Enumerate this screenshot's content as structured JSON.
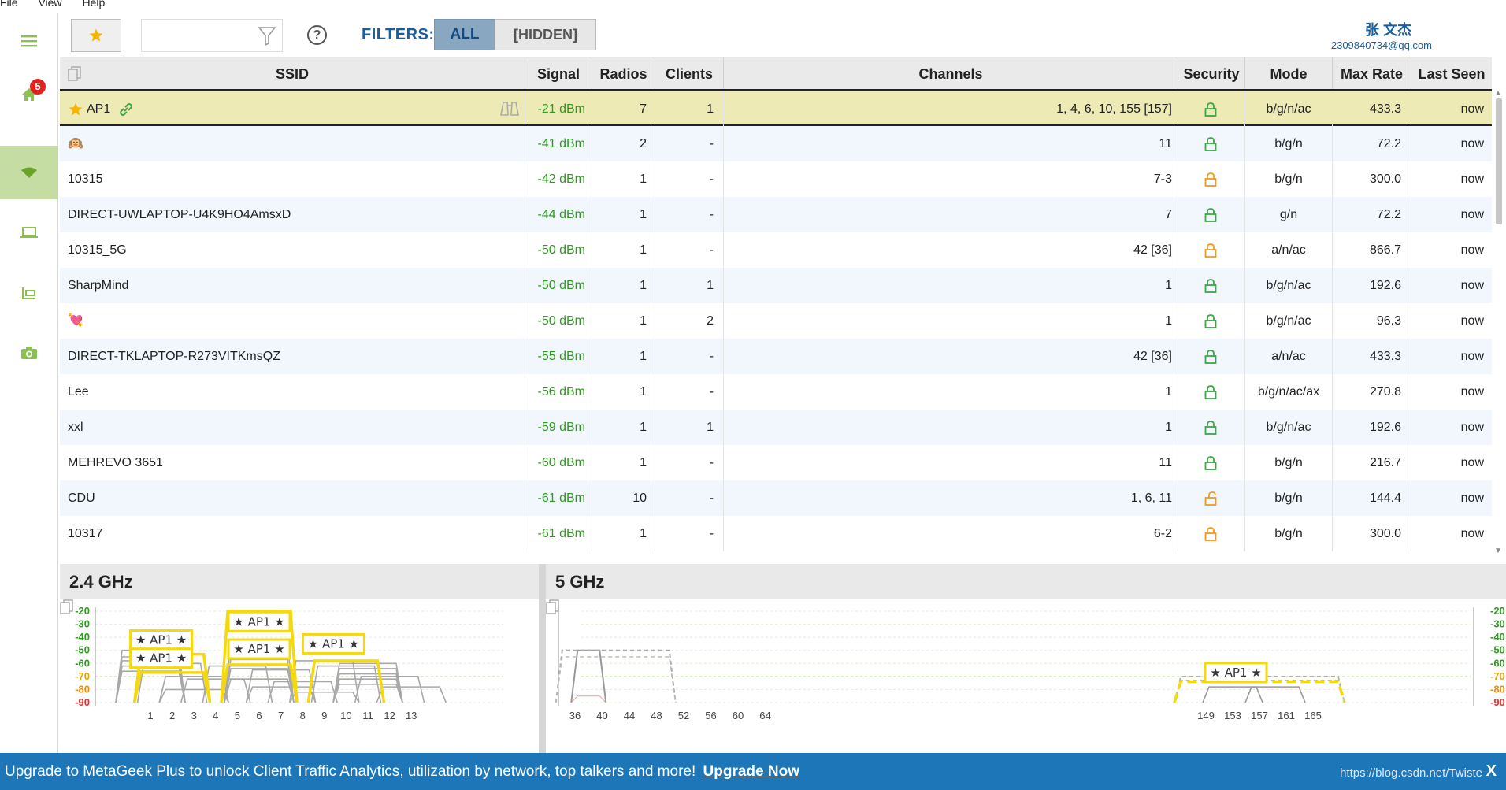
{
  "menu": [
    "File",
    "View",
    "Help"
  ],
  "sidebar": {
    "badge_count": "5",
    "items": [
      {
        "name": "menu",
        "icon": "hamburger-icon"
      },
      {
        "name": "home",
        "icon": "home-icon"
      },
      {
        "name": "wifi",
        "icon": "wifi-icon",
        "active": true
      },
      {
        "name": "devices",
        "icon": "laptop-icon"
      },
      {
        "name": "files",
        "icon": "folders-icon"
      },
      {
        "name": "camera",
        "icon": "camera-icon"
      }
    ]
  },
  "toolbar": {
    "search_value": "",
    "filters_label": "FILTERS:",
    "filter_all": "ALL",
    "filter_hidden": "[HIDDEN]",
    "user_name": "张 文杰",
    "user_email": "2309840734@qq.com"
  },
  "table": {
    "headers": {
      "ssid": "SSID",
      "signal": "Signal",
      "radios": "Radios",
      "clients": "Clients",
      "channels": "Channels",
      "security": "Security",
      "mode": "Mode",
      "max_rate": "Max Rate",
      "last_seen": "Last Seen"
    },
    "rows": [
      {
        "ssid": "AP1",
        "signal": "-21 dBm",
        "radios": "7",
        "clients": "1",
        "channels": "1, 4, 6, 10, 155 [157]",
        "security": "green",
        "mode": "b/g/n/ac",
        "max_rate": "433.3",
        "last_seen": "now",
        "favorite": true
      },
      {
        "ssid": "🙉",
        "signal": "-41 dBm",
        "radios": "2",
        "clients": "-",
        "channels": "11",
        "security": "green",
        "mode": "b/g/n",
        "max_rate": "72.2",
        "last_seen": "now"
      },
      {
        "ssid": "10315",
        "signal": "-42 dBm",
        "radios": "1",
        "clients": "-",
        "channels": "7-3",
        "security": "orange",
        "mode": "b/g/n",
        "max_rate": "300.0",
        "last_seen": "now"
      },
      {
        "ssid": "DIRECT-UWLAPTOP-U4K9HO4AmsxD",
        "signal": "-44 dBm",
        "radios": "1",
        "clients": "-",
        "channels": "7",
        "security": "green",
        "mode": "g/n",
        "max_rate": "72.2",
        "last_seen": "now"
      },
      {
        "ssid": "10315_5G",
        "signal": "-50 dBm",
        "radios": "1",
        "clients": "-",
        "channels": "42 [36]",
        "security": "orange",
        "mode": "a/n/ac",
        "max_rate": "866.7",
        "last_seen": "now"
      },
      {
        "ssid": "SharpMind",
        "signal": "-50 dBm",
        "radios": "1",
        "clients": "1",
        "channels": "1",
        "security": "green",
        "mode": "b/g/n/ac",
        "max_rate": "192.6",
        "last_seen": "now"
      },
      {
        "ssid": "💘",
        "signal": "-50 dBm",
        "radios": "1",
        "clients": "2",
        "channels": "1",
        "security": "green",
        "mode": "b/g/n/ac",
        "max_rate": "96.3",
        "last_seen": "now"
      },
      {
        "ssid": "DIRECT-TKLAPTOP-R273VITKmsQZ",
        "signal": "-55 dBm",
        "radios": "1",
        "clients": "-",
        "channels": "42 [36]",
        "security": "green",
        "mode": "a/n/ac",
        "max_rate": "433.3",
        "last_seen": "now"
      },
      {
        "ssid": "Lee",
        "signal": "-56 dBm",
        "radios": "1",
        "clients": "-",
        "channels": "1",
        "security": "green",
        "mode": "b/g/n/ac/ax",
        "max_rate": "270.8",
        "last_seen": "now"
      },
      {
        "ssid": "xxl",
        "signal": "-59 dBm",
        "radios": "1",
        "clients": "1",
        "channels": "1",
        "security": "green",
        "mode": "b/g/n/ac",
        "max_rate": "192.6",
        "last_seen": "now"
      },
      {
        "ssid": "MEHREVO 3651",
        "signal": "-60 dBm",
        "radios": "1",
        "clients": "-",
        "channels": "11",
        "security": "green",
        "mode": "b/g/n",
        "max_rate": "216.7",
        "last_seen": "now"
      },
      {
        "ssid": "CDU",
        "signal": "-61 dBm",
        "radios": "10",
        "clients": "-",
        "channels": "1, 6, 11",
        "security": "open",
        "mode": "b/g/n",
        "max_rate": "144.4",
        "last_seen": "now"
      },
      {
        "ssid": "10317",
        "signal": "-61 dBm",
        "radios": "1",
        "clients": "-",
        "channels": "6-2",
        "security": "orange",
        "mode": "b/g/n",
        "max_rate": "300.0",
        "last_seen": "now"
      }
    ]
  },
  "colors": {
    "accent_green": "#8cc152",
    "signal_green": "#2f9a1f",
    "lock_green": "#3aa845",
    "lock_orange": "#f39a1e",
    "highlight_yellow": "#f5d90a",
    "banner_blue": "#1d76b8"
  },
  "chart_data": [
    {
      "type": "area",
      "title": "2.4 GHz",
      "x_ticks": [
        "1",
        "2",
        "3",
        "4",
        "5",
        "6",
        "7",
        "8",
        "9",
        "10",
        "11",
        "12",
        "13"
      ],
      "y_ticks": [
        "-20",
        "-30",
        "-40",
        "-50",
        "-60",
        "-70",
        "-80",
        "-90"
      ],
      "ylim": [
        -90,
        -20
      ],
      "highlight": [
        {
          "label": "★ AP1 ★",
          "center_channel": 2,
          "top_dbm": -53
        },
        {
          "label": "★ AP1 ★",
          "center_channel": 2,
          "top_dbm": -67
        },
        {
          "label": "★ AP1 ★",
          "center_channel": 6,
          "top_dbm": -20
        },
        {
          "label": "★ AP1 ★",
          "center_channel": 6,
          "top_dbm": -61
        },
        {
          "label": "★ AP1 ★",
          "center_channel": 10,
          "top_dbm": -58
        }
      ]
    },
    {
      "type": "area",
      "title": "5 GHz",
      "x_ticks": [
        "36",
        "40",
        "44",
        "48",
        "52",
        "56",
        "60",
        "64",
        "149",
        "153",
        "157",
        "161",
        "165"
      ],
      "y_ticks": [
        "-20",
        "-30",
        "-40",
        "-50",
        "-60",
        "-70",
        "-80",
        "-90"
      ],
      "ylim": [
        -90,
        -20
      ],
      "highlight": [
        {
          "label": "★ AP1 ★",
          "center_channel": 157,
          "top_dbm": -74
        }
      ]
    }
  ],
  "banner": {
    "text": "Upgrade to MetaGeek Plus to unlock Client Traffic Analytics, utilization by network, top talkers and more!",
    "link": "Upgrade Now",
    "url": "https://blog.csdn.net/Twiste",
    "close": "X"
  }
}
